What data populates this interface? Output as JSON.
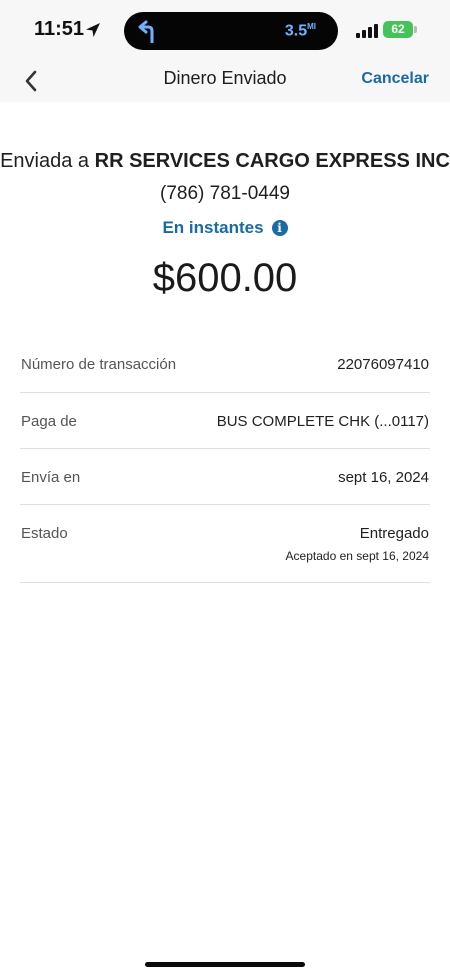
{
  "status_bar": {
    "time": "11:51",
    "location_icon": "location-arrow-icon",
    "nav_turn_icon": "turn-left-arrow-icon",
    "distance": "3.5",
    "distance_unit": "MI",
    "signal_icon": "cellular-signal-icon",
    "battery_level": "62"
  },
  "nav": {
    "back_icon": "chevron-left-icon",
    "title": "Dinero Enviado",
    "cancel_label": "Cancelar"
  },
  "summary": {
    "sent_prefix": "Enviada a",
    "recipient": "RR SERVICES CARGO EXPRESS INC",
    "phone": "(786) 781-0449",
    "speed": "En instantes",
    "info_icon": "info-icon",
    "amount": "$600.00"
  },
  "details": {
    "transaction_label": "Número de transacción",
    "transaction_value": "22076097410",
    "pay_from_label": "Paga de",
    "pay_from_value": "BUS COMPLETE CHK (...0117)",
    "send_on_label": "Envía en",
    "send_on_value": "sept 16, 2024",
    "status_label": "Estado",
    "status_value": "Entregado",
    "status_sub": "Aceptado en sept 16, 2024"
  },
  "colors": {
    "accent": "#1a6aa3",
    "header_bg": "#f7f7f8",
    "battery": "#45c25a",
    "island_text": "#6fb3ff"
  }
}
